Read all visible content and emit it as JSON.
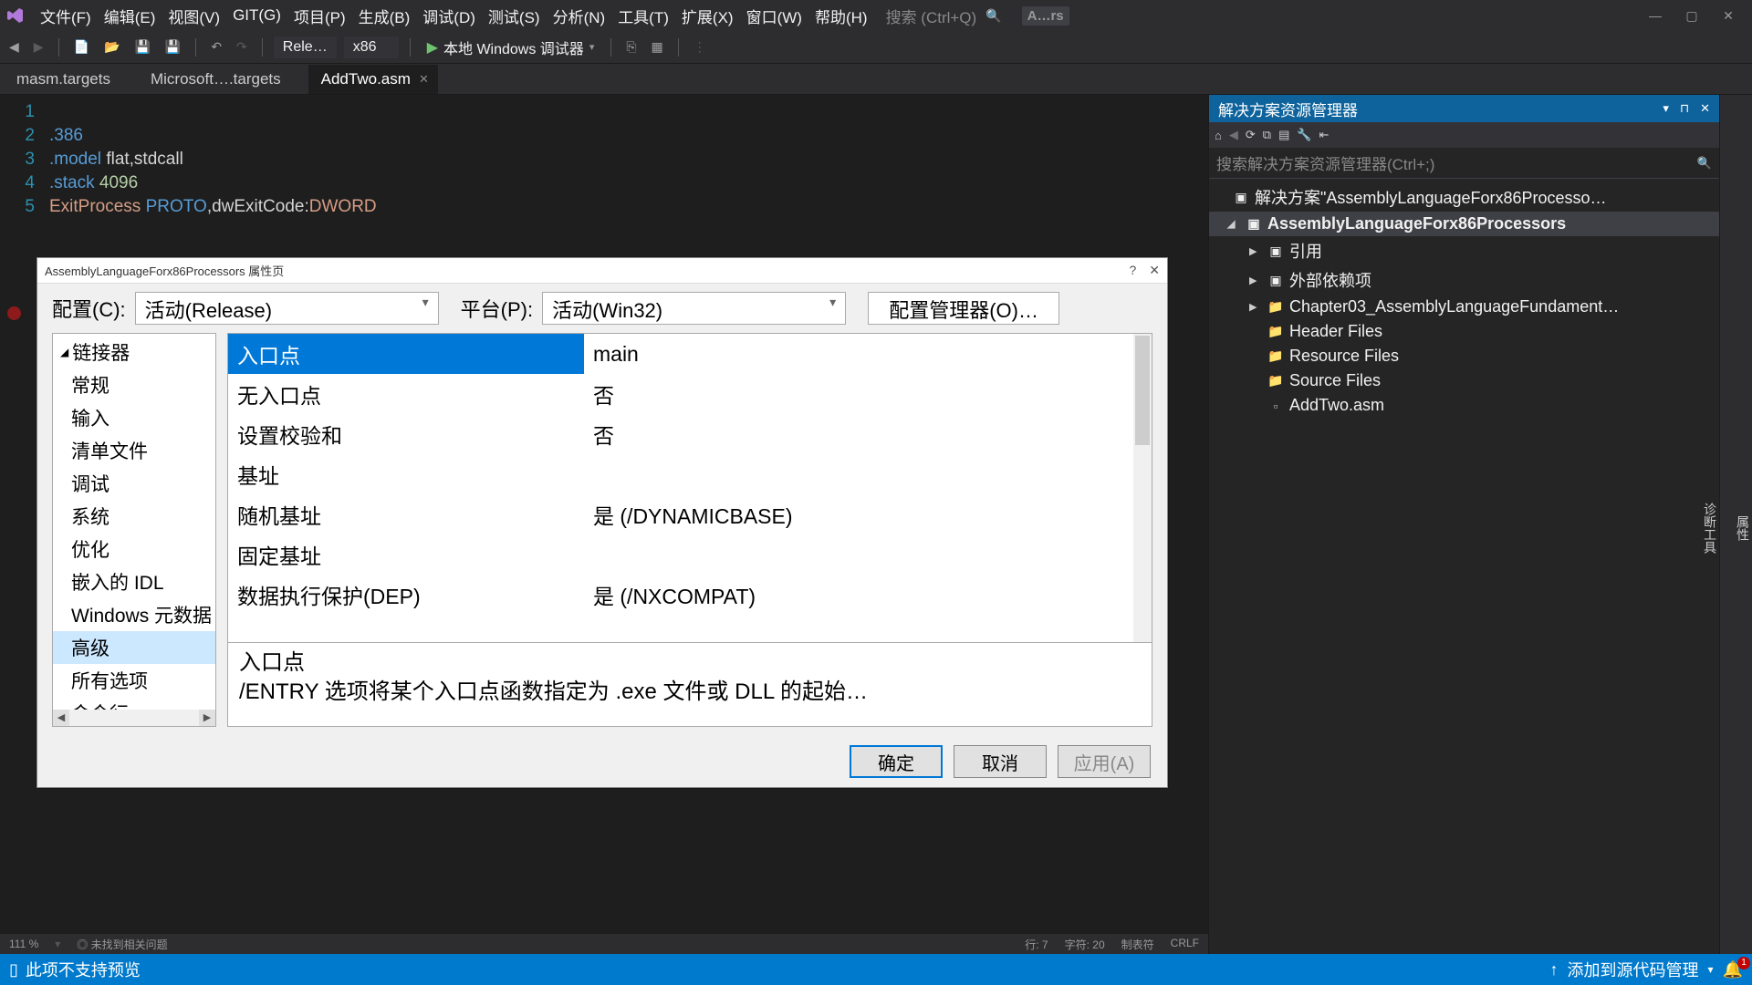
{
  "menu": {
    "items": [
      "文件(F)",
      "编辑(E)",
      "视图(V)",
      "GIT(G)",
      "项目(P)",
      "生成(B)",
      "调试(D)",
      "测试(S)",
      "分析(N)",
      "工具(T)",
      "扩展(X)",
      "窗口(W)",
      "帮助(H)"
    ],
    "search_placeholder": "搜索 (Ctrl+Q)",
    "project_badge": "A…rs"
  },
  "toolbar": {
    "config": "Rele…",
    "platform": "x86",
    "debug_target": "本地 Windows 调试器"
  },
  "tabs": {
    "items": [
      "masm.targets",
      "Microsoft….targets",
      "AddTwo.asm"
    ],
    "active": 2
  },
  "code": {
    "lines": [
      {
        "n": 1,
        "html": ""
      },
      {
        "n": 2,
        "html": "<span class='kw'>.386</span>"
      },
      {
        "n": 3,
        "html": "<span class='kw'>.model</span> <span class='p'>flat,stdcall</span>"
      },
      {
        "n": 4,
        "html": "<span class='kw'>.stack</span> <span class='num'>4096</span>"
      },
      {
        "n": 5,
        "html": "<span class='id'>ExitProcess</span> <span class='kw'>PROTO</span><span class='p'>,dwExitCode:</span><span class='id'>DWORD</span>"
      }
    ]
  },
  "editor_status": {
    "zoom": "111 %",
    "issues": "◎ 未找到相关问题",
    "line": "行: 7",
    "col": "字符: 20",
    "tabs": "制表符",
    "eol": "CRLF"
  },
  "solution": {
    "title": "解决方案资源管理器",
    "search_placeholder": "搜索解决方案资源管理器(Ctrl+;)",
    "root": "解决方案\"AssemblyLanguageForx86Processo…",
    "project": "AssemblyLanguageForx86Processors",
    "nodes": [
      {
        "label": "引用",
        "exp": "▶",
        "ic": "▣",
        "depth": 2
      },
      {
        "label": "外部依赖项",
        "exp": "▶",
        "ic": "▣",
        "depth": 2
      },
      {
        "label": "Chapter03_AssemblyLanguageFundament…",
        "exp": "▶",
        "ic": "📁",
        "depth": 2
      },
      {
        "label": "Header Files",
        "exp": "",
        "ic": "📁",
        "depth": 3
      },
      {
        "label": "Resource Files",
        "exp": "",
        "ic": "📁",
        "depth": 3
      },
      {
        "label": "Source Files",
        "exp": "",
        "ic": "📁",
        "depth": 3
      },
      {
        "label": "AddTwo.asm",
        "exp": "",
        "ic": "▫",
        "depth": 3
      }
    ]
  },
  "dialog": {
    "title": "AssemblyLanguageForx86Processors 属性页",
    "config_label": "配置(C):",
    "config_value": "活动(Release)",
    "platform_label": "平台(P):",
    "platform_value": "活动(Win32)",
    "cfgmgr": "配置管理器(O)…",
    "tree_root": "链接器",
    "tree_items": [
      "常规",
      "输入",
      "清单文件",
      "调试",
      "系统",
      "优化",
      "嵌入的 IDL",
      "Windows 元数据",
      "高级",
      "所有选项",
      "命令行"
    ],
    "tree_selected": "高级",
    "grid": [
      {
        "name": "入口点",
        "value": "main",
        "sel": true,
        "editable": true
      },
      {
        "name": "无入口点",
        "value": "否"
      },
      {
        "name": "设置校验和",
        "value": "否"
      },
      {
        "name": "基址",
        "value": ""
      },
      {
        "name": "随机基址",
        "value": "是 (/DYNAMICBASE)"
      },
      {
        "name": "固定基址",
        "value": ""
      },
      {
        "name": "数据执行保护(DEP)",
        "value": "是 (/NXCOMPAT)"
      }
    ],
    "desc_title": "入口点",
    "desc_body": "/ENTRY 选项将某个入口点函数指定为 .exe 文件或 DLL 的起始…",
    "ok": "确定",
    "cancel": "取消",
    "apply": "应用(A)"
  },
  "statusbar": {
    "left": "此项不支持预览",
    "right": "添加到源代码管理",
    "badge": "1"
  },
  "side_tabs": [
    "属性",
    "诊断工具"
  ]
}
